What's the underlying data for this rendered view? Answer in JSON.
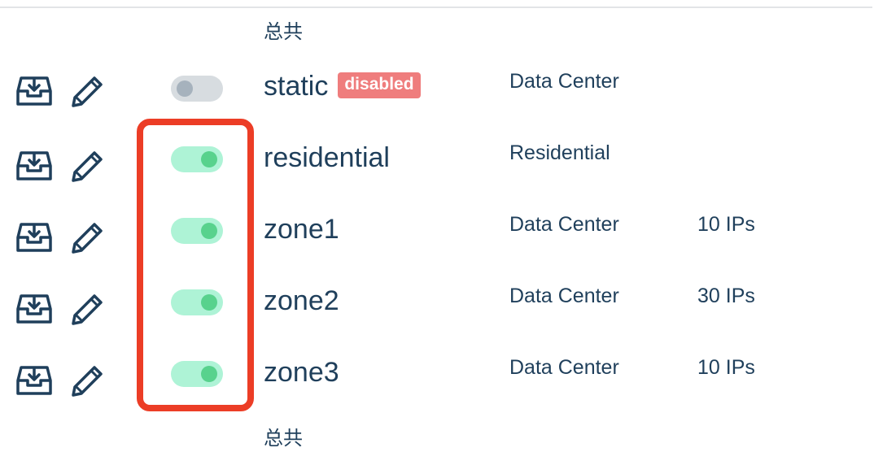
{
  "header": {
    "total_label": "总共"
  },
  "footer": {
    "total_label": "总共"
  },
  "colors": {
    "accent_text": "#1f3f5b",
    "toggle_on": "#aef3d6",
    "toggle_on_knob": "#58d28d",
    "toggle_off": "#d7dce0",
    "disabled_badge": "#ef7d7d",
    "highlight_box": "#ec3d26"
  },
  "rows": [
    {
      "name": "static",
      "badge": "disabled",
      "type": "Data Center",
      "ips": "",
      "enabled": false,
      "icons": [
        "export-icon",
        "pencil-icon"
      ]
    },
    {
      "name": "residential",
      "badge": "",
      "type": "Residential",
      "ips": "",
      "enabled": true,
      "icons": [
        "export-icon",
        "pencil-icon"
      ]
    },
    {
      "name": "zone1",
      "badge": "",
      "type": "Data Center",
      "ips": "10 IPs",
      "enabled": true,
      "icons": [
        "export-icon",
        "pencil-icon"
      ]
    },
    {
      "name": "zone2",
      "badge": "",
      "type": "Data Center",
      "ips": "30 IPs",
      "enabled": true,
      "icons": [
        "export-icon",
        "pencil-icon"
      ]
    },
    {
      "name": "zone3",
      "badge": "",
      "type": "Data Center",
      "ips": "10 IPs",
      "enabled": true,
      "icons": [
        "export-icon",
        "pencil-icon"
      ]
    }
  ]
}
